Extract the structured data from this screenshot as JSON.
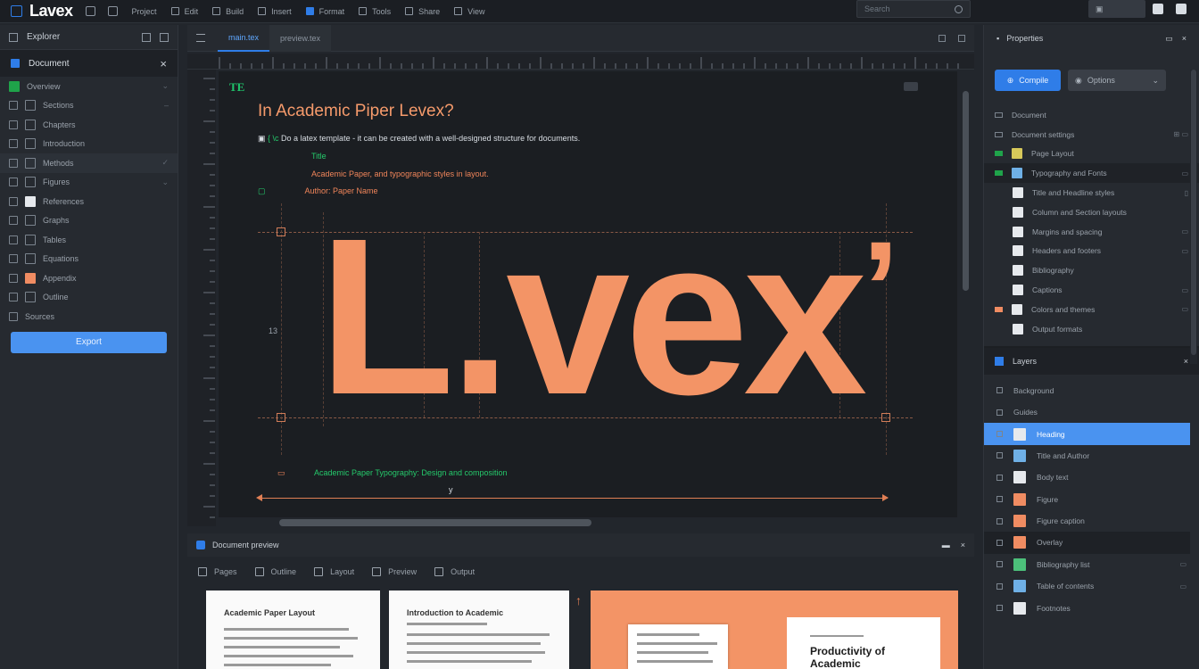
{
  "app": {
    "name": "Lavex"
  },
  "topbar": {
    "items": [
      "Project",
      "Edit",
      "Build",
      "Insert",
      "Format",
      "Tools",
      "Share",
      "View"
    ],
    "search_placeholder": "Search"
  },
  "left_panel": {
    "title": "Explorer",
    "project": "Document",
    "items": [
      "Overview",
      "Sections",
      "Chapters",
      "Introduction",
      "Methods",
      "Figures",
      "References",
      "Graphs",
      "Tables",
      "Equations",
      "Appendix",
      "Outline",
      "Sources"
    ],
    "button_label": "Export"
  },
  "editor": {
    "tabs": [
      "main.tex",
      "preview.tex"
    ],
    "badge": "TE",
    "title": "In Academic Piper Levex?",
    "line1": "Do a latex template - it can be created with a well-designed structure for documents.",
    "line2": "Title",
    "line3": "Academic Paper, and typographic styles in layout.",
    "line4": "Author: Paper Name",
    "big_text": "L.vex",
    "apostrophe": "’",
    "caption": "Academic Paper Typography: Design and composition",
    "side_label": "13",
    "width_label": "y",
    "colors": {
      "accent": "#2f7de8",
      "title": "#f59a6b",
      "code_green": "#25c96b",
      "code_orange": "#f0855a"
    }
  },
  "bottom": {
    "title": "Document preview",
    "tabs": [
      "Pages",
      "Outline",
      "Layout",
      "Preview",
      "Output"
    ],
    "cards": [
      {
        "title": "Academic Paper Layout"
      },
      {
        "title": "Introduction to Academic"
      }
    ],
    "preview_heading1": "Productivity of",
    "preview_heading2": "Academic"
  },
  "right_panel": {
    "title": "Properties",
    "primary_button": "Compile",
    "secondary_button": "Options",
    "tree": [
      "Document",
      "Document settings",
      "Page Layout",
      "Typography and Fonts",
      "Title and Headline styles",
      "Column and Section layouts",
      "Margins and spacing",
      "Headers and footers",
      "Bibliography",
      "Captions",
      "Colors and themes",
      "Output formats"
    ],
    "layers_title": "Layers",
    "layers": [
      "Background",
      "Guides",
      "Heading",
      "Title and Author",
      "Body text",
      "Figure",
      "Figure caption",
      "Overlay",
      "Bibliography list",
      "Table of contents",
      "Footnotes"
    ]
  }
}
